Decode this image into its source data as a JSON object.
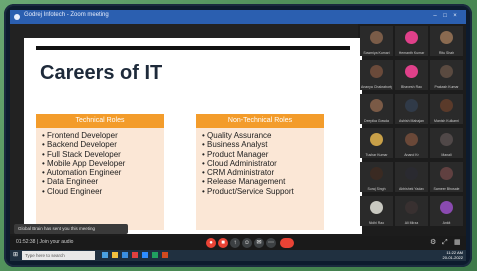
{
  "window": {
    "title": "Godrej Infotech - Zoom meeting"
  },
  "slide": {
    "title": "Careers of IT",
    "technical": {
      "heading": "Technical Roles",
      "items": [
        "Frontend Developer",
        "Backend Developer",
        "Full Stack Developer",
        "Mobile App Developer",
        "Automation Engineer",
        "Data Engineer",
        "Cloud Engineer"
      ]
    },
    "nontechnical": {
      "heading": "Non-Technical Roles",
      "items": [
        "Quality Assurance",
        "Business Analyst",
        "Product Manager",
        "Cloud Administrator",
        "CRM Administrator",
        "Release Management",
        "Product/Service Support"
      ]
    }
  },
  "notification": {
    "text": "Global Brain has sent you this meeting"
  },
  "participants": [
    {
      "name": "Sowmiya Kumari",
      "color": "#7a5c48"
    },
    {
      "name": "Hemanth Kumar",
      "color": "#e0408a"
    },
    {
      "name": "Ritu Shah",
      "color": "#8a6a50"
    },
    {
      "name": "Ananya Chakraborty",
      "color": "#6a4a3a"
    },
    {
      "name": "Bhavesh Rao",
      "color": "#e0408a"
    },
    {
      "name": "Prakash Kumar",
      "color": "#5a4a40"
    },
    {
      "name": "Deepika Gowda",
      "color": "#7a5a46"
    },
    {
      "name": "Ashish Mahajan",
      "color": "#303a48"
    },
    {
      "name": "Manish Kulkarni",
      "color": "#5a3a2a"
    },
    {
      "name": "Tushar Kumar",
      "color": "#c8a048"
    },
    {
      "name": "Anand Kr",
      "color": "#6a4838"
    },
    {
      "name": "Manali",
      "color": "#504848"
    },
    {
      "name": "Suraj Singh",
      "color": "#3a2a22"
    },
    {
      "name": "Abhishek Yadav",
      "color": "#2a2a30"
    },
    {
      "name": "Sameer Bhosale",
      "color": "#604040"
    },
    {
      "name": "Nidhi Rao",
      "color": "#c8c8c0"
    },
    {
      "name": "Ali Mirza",
      "color": "#383030"
    },
    {
      "name": "Ankit",
      "color": "#8a4ab0"
    }
  ],
  "controls": {
    "meeting_time": "01:52:38",
    "meeting_label": "Join your audio",
    "unmute_icon": "mic-off-icon",
    "video_icon": "video-off-icon",
    "share_icon": "share-screen-icon",
    "participants_icon": "people-icon",
    "chat_icon": "chat-icon",
    "more_icon": "more-icon",
    "end_icon": "end-call-icon"
  },
  "taskbar": {
    "search_placeholder": "Type here to search",
    "time": "11:22 AM",
    "date": "20-01-2022"
  }
}
